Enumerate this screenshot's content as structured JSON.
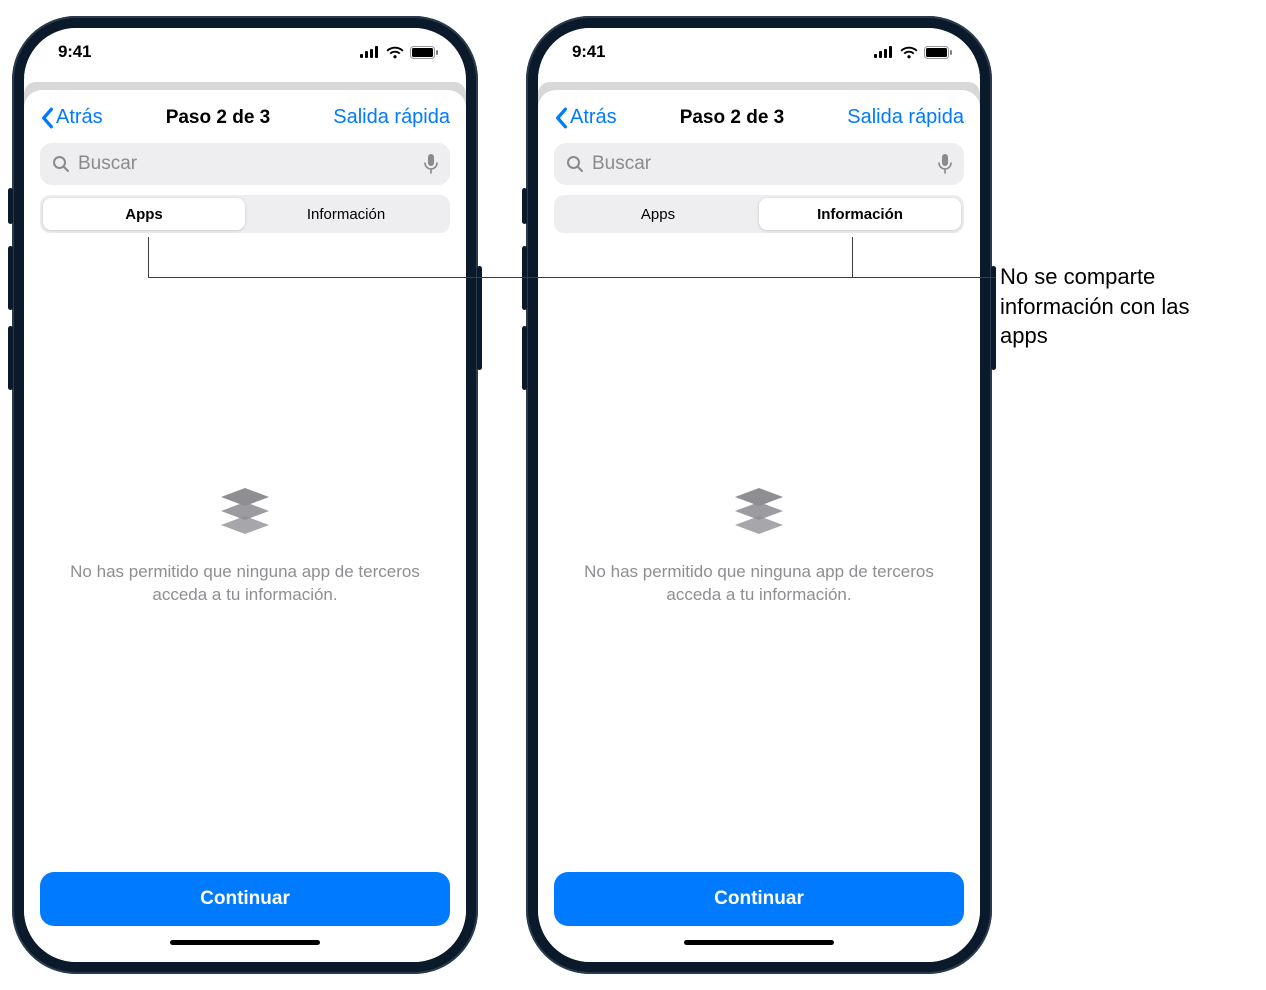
{
  "status": {
    "time": "9:41"
  },
  "nav": {
    "back_label": "Atrás",
    "title": "Paso 2 de 3",
    "exit_label": "Salida rápida"
  },
  "search": {
    "placeholder": "Buscar"
  },
  "tabs": {
    "apps": "Apps",
    "info": "Información"
  },
  "empty_state": {
    "message": "No has permitido que ninguna app de terceros acceda a tu información."
  },
  "footer": {
    "continue_label": "Continuar"
  },
  "callout": {
    "text": "No se comparte información con las apps"
  },
  "phones": [
    {
      "active_tab": "apps"
    },
    {
      "active_tab": "info"
    }
  ]
}
